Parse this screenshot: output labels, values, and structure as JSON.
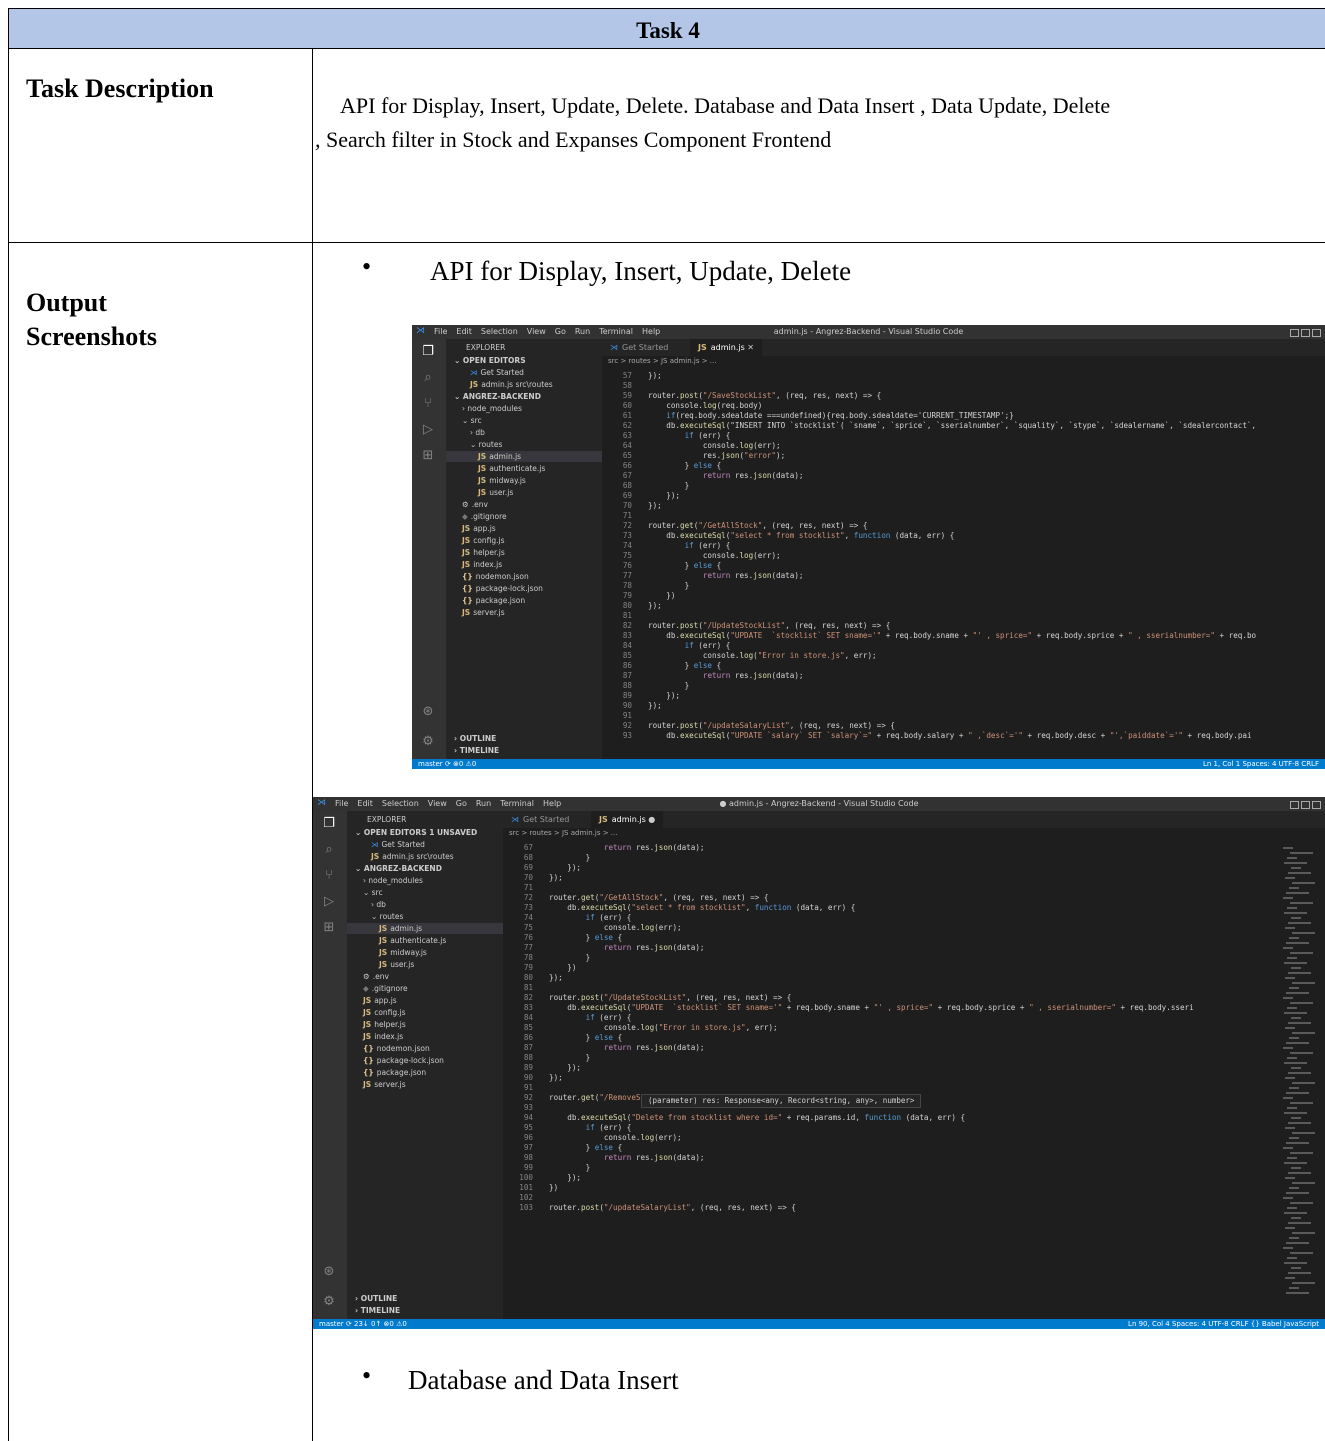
{
  "task_title": "Task 4",
  "task_description_label": "Task Description",
  "task_description_line1": "API for Display, Insert, Update, Delete. Database and Data Insert , Data Update, Delete",
  "task_description_line2": ", Search filter in Stock and Expanses Component Frontend",
  "output_label_line1": "Output",
  "output_label_line2": "Screenshots",
  "bullet1": "API for Display, Insert, Update, Delete",
  "bullet2": "Database and Data Insert",
  "shot1": {
    "menu": [
      "File",
      "Edit",
      "Selection",
      "View",
      "Go",
      "Run",
      "Terminal",
      "Help"
    ],
    "window_title": "admin.js - Angrez-Backend - Visual Studio Code",
    "tabs": [
      "Get Started",
      "admin.js"
    ],
    "breadcrumb": "src > routes > JS admin.js > ...",
    "explorer_label": "EXPLORER",
    "sidebar": [
      "OPEN EDITORS",
      "Get Started",
      "admin.js src\\routes",
      "ANGREZ-BACKEND",
      "node_modules",
      "src",
      "db",
      "routes",
      "admin.js",
      "authenticate.js",
      "midway.js",
      "user.js",
      ".env",
      ".gitignore",
      "app.js",
      "config.js",
      "helper.js",
      "index.js",
      "nodemon.json",
      "package-lock.json",
      "package.json",
      "server.js",
      "OUTLINE",
      "TIMELINE"
    ],
    "code": [
      {
        "n": "57",
        "t": "});"
      },
      {
        "n": "58",
        "t": ""
      },
      {
        "n": "59",
        "t": "router.post(\"/SaveStockList\", (req, res, next) => {"
      },
      {
        "n": "60",
        "t": "    console.log(req.body)"
      },
      {
        "n": "61",
        "t": "    if(req.body.sdealdate ===undefined){req.body.sdealdate='CURRENT_TIMESTAMP';}"
      },
      {
        "n": "62",
        "t": "    db.executeSql(\"INSERT INTO `stocklist`( `sname`, `sprice`, `sserialnumber`, `squality`, `stype`, `sdealername`, `sdealercontact`,"
      },
      {
        "n": "63",
        "t": "        if (err) {"
      },
      {
        "n": "64",
        "t": "            console.log(err);"
      },
      {
        "n": "65",
        "t": "            res.json(\"error\");"
      },
      {
        "n": "66",
        "t": "        } else {"
      },
      {
        "n": "67",
        "t": "            return res.json(data);"
      },
      {
        "n": "68",
        "t": "        }"
      },
      {
        "n": "69",
        "t": "    });"
      },
      {
        "n": "70",
        "t": "});"
      },
      {
        "n": "71",
        "t": ""
      },
      {
        "n": "72",
        "t": "router.get(\"/GetAllStock\", (req, res, next) => {"
      },
      {
        "n": "73",
        "t": "    db.executeSql(\"select * from stocklist\", function (data, err) {"
      },
      {
        "n": "74",
        "t": "        if (err) {"
      },
      {
        "n": "75",
        "t": "            console.log(err);"
      },
      {
        "n": "76",
        "t": "        } else {"
      },
      {
        "n": "77",
        "t": "            return res.json(data);"
      },
      {
        "n": "78",
        "t": "        }"
      },
      {
        "n": "79",
        "t": "    })"
      },
      {
        "n": "80",
        "t": "});"
      },
      {
        "n": "81",
        "t": ""
      },
      {
        "n": "82",
        "t": "router.post(\"/UpdateStockList\", (req, res, next) => {"
      },
      {
        "n": "83",
        "t": "    db.executeSql(\"UPDATE  `stocklist` SET sname='\" + req.body.sname + \"' , sprice=\" + req.body.sprice + \" , sserialnumber=\" + req.bo"
      },
      {
        "n": "84",
        "t": "        if (err) {"
      },
      {
        "n": "85",
        "t": "            console.log(\"Error in store.js\", err);"
      },
      {
        "n": "86",
        "t": "        } else {"
      },
      {
        "n": "87",
        "t": "            return res.json(data);"
      },
      {
        "n": "88",
        "t": "        }"
      },
      {
        "n": "89",
        "t": "    });"
      },
      {
        "n": "90",
        "t": "});"
      },
      {
        "n": "91",
        "t": ""
      },
      {
        "n": "92",
        "t": "router.post(\"/updateSalaryList\", (req, res, next) => {"
      },
      {
        "n": "93",
        "t": "    db.executeSql(\"UPDATE `salary` SET `salary`=\" + req.body.salary + \" ,`desc`='\" + req.body.desc + \"',`paiddate`='\" + req.body.pai"
      }
    ],
    "status_left": "master  ⟳  ⊗0 ⚠0",
    "status_right": "Ln 1, Col 1   Spaces: 4   UTF-8   CRLF"
  },
  "shot2": {
    "menu": [
      "File",
      "Edit",
      "Selection",
      "View",
      "Go",
      "Run",
      "Terminal",
      "Help"
    ],
    "window_title": "● admin.js - Angrez-Backend - Visual Studio Code",
    "tabs": [
      "Get Started",
      "admin.js"
    ],
    "breadcrumb": "src > routes > JS admin.js > ...",
    "explorer_label": "EXPLORER",
    "sidebar": [
      "OPEN EDITORS  1 UNSAVED",
      "Get Started",
      "admin.js src\\routes",
      "ANGREZ-BACKEND",
      "node_modules",
      "src",
      "db",
      "routes",
      "admin.js",
      "authenticate.js",
      "midway.js",
      "user.js",
      ".env",
      ".gitignore",
      "app.js",
      "config.js",
      "helper.js",
      "index.js",
      "nodemon.json",
      "package-lock.json",
      "package.json",
      "server.js",
      "OUTLINE",
      "TIMELINE"
    ],
    "code": [
      {
        "n": "67",
        "t": "            return res.json(data);"
      },
      {
        "n": "68",
        "t": "        }"
      },
      {
        "n": "69",
        "t": "    });"
      },
      {
        "n": "70",
        "t": "});"
      },
      {
        "n": "71",
        "t": ""
      },
      {
        "n": "72",
        "t": "router.get(\"/GetAllStock\", (req, res, next) => {"
      },
      {
        "n": "73",
        "t": "    db.executeSql(\"select * from stocklist\", function (data, err) {"
      },
      {
        "n": "74",
        "t": "        if (err) {"
      },
      {
        "n": "75",
        "t": "            console.log(err);"
      },
      {
        "n": "76",
        "t": "        } else {"
      },
      {
        "n": "77",
        "t": "            return res.json(data);"
      },
      {
        "n": "78",
        "t": "        }"
      },
      {
        "n": "79",
        "t": "    })"
      },
      {
        "n": "80",
        "t": "});"
      },
      {
        "n": "81",
        "t": ""
      },
      {
        "n": "82",
        "t": "router.post(\"/UpdateStockList\", (req, res, next) => {"
      },
      {
        "n": "83",
        "t": "    db.executeSql(\"UPDATE  `stocklist` SET sname='\" + req.body.sname + \"' , sprice=\" + req.body.sprice + \" , sserialnumber=\" + req.body.sseri"
      },
      {
        "n": "84",
        "t": "        if (err) {"
      },
      {
        "n": "85",
        "t": "            console.log(\"Error in store.js\", err);"
      },
      {
        "n": "86",
        "t": "        } else {"
      },
      {
        "n": "87",
        "t": "            return res.json(data);"
      },
      {
        "n": "88",
        "t": "        }"
      },
      {
        "n": "89",
        "t": "    });"
      },
      {
        "n": "90",
        "t": "});"
      },
      {
        "n": "91",
        "t": ""
      },
      {
        "n": "92",
        "t": "router.get(\"/RemoveStockList/:id\", (req, res, next) => {"
      },
      {
        "n": "93",
        "t": ""
      },
      {
        "n": "94",
        "t": "    db.executeSql(\"Delete from stocklist where id=\" + req.params.id, function (data, err) {"
      },
      {
        "n": "95",
        "t": "        if (err) {"
      },
      {
        "n": "96",
        "t": "            console.log(err);"
      },
      {
        "n": "97",
        "t": "        } else {"
      },
      {
        "n": "98",
        "t": "            return res.json(data);"
      },
      {
        "n": "99",
        "t": "        }"
      },
      {
        "n": "100",
        "t": "    });"
      },
      {
        "n": "101",
        "t": "})"
      },
      {
        "n": "102",
        "t": ""
      },
      {
        "n": "103",
        "t": "router.post(\"/updateSalaryList\", (req, res, next) => {"
      }
    ],
    "tooltip": "(parameter) res: Response<any, Record<string, any>, number>",
    "status_left": "master  ⟳ 23↓ 0↑  ⊗0 ⚠0",
    "status_right": "Ln 90, Col 4   Spaces: 4   UTF-8   CRLF   {} Babel JavaScript"
  }
}
